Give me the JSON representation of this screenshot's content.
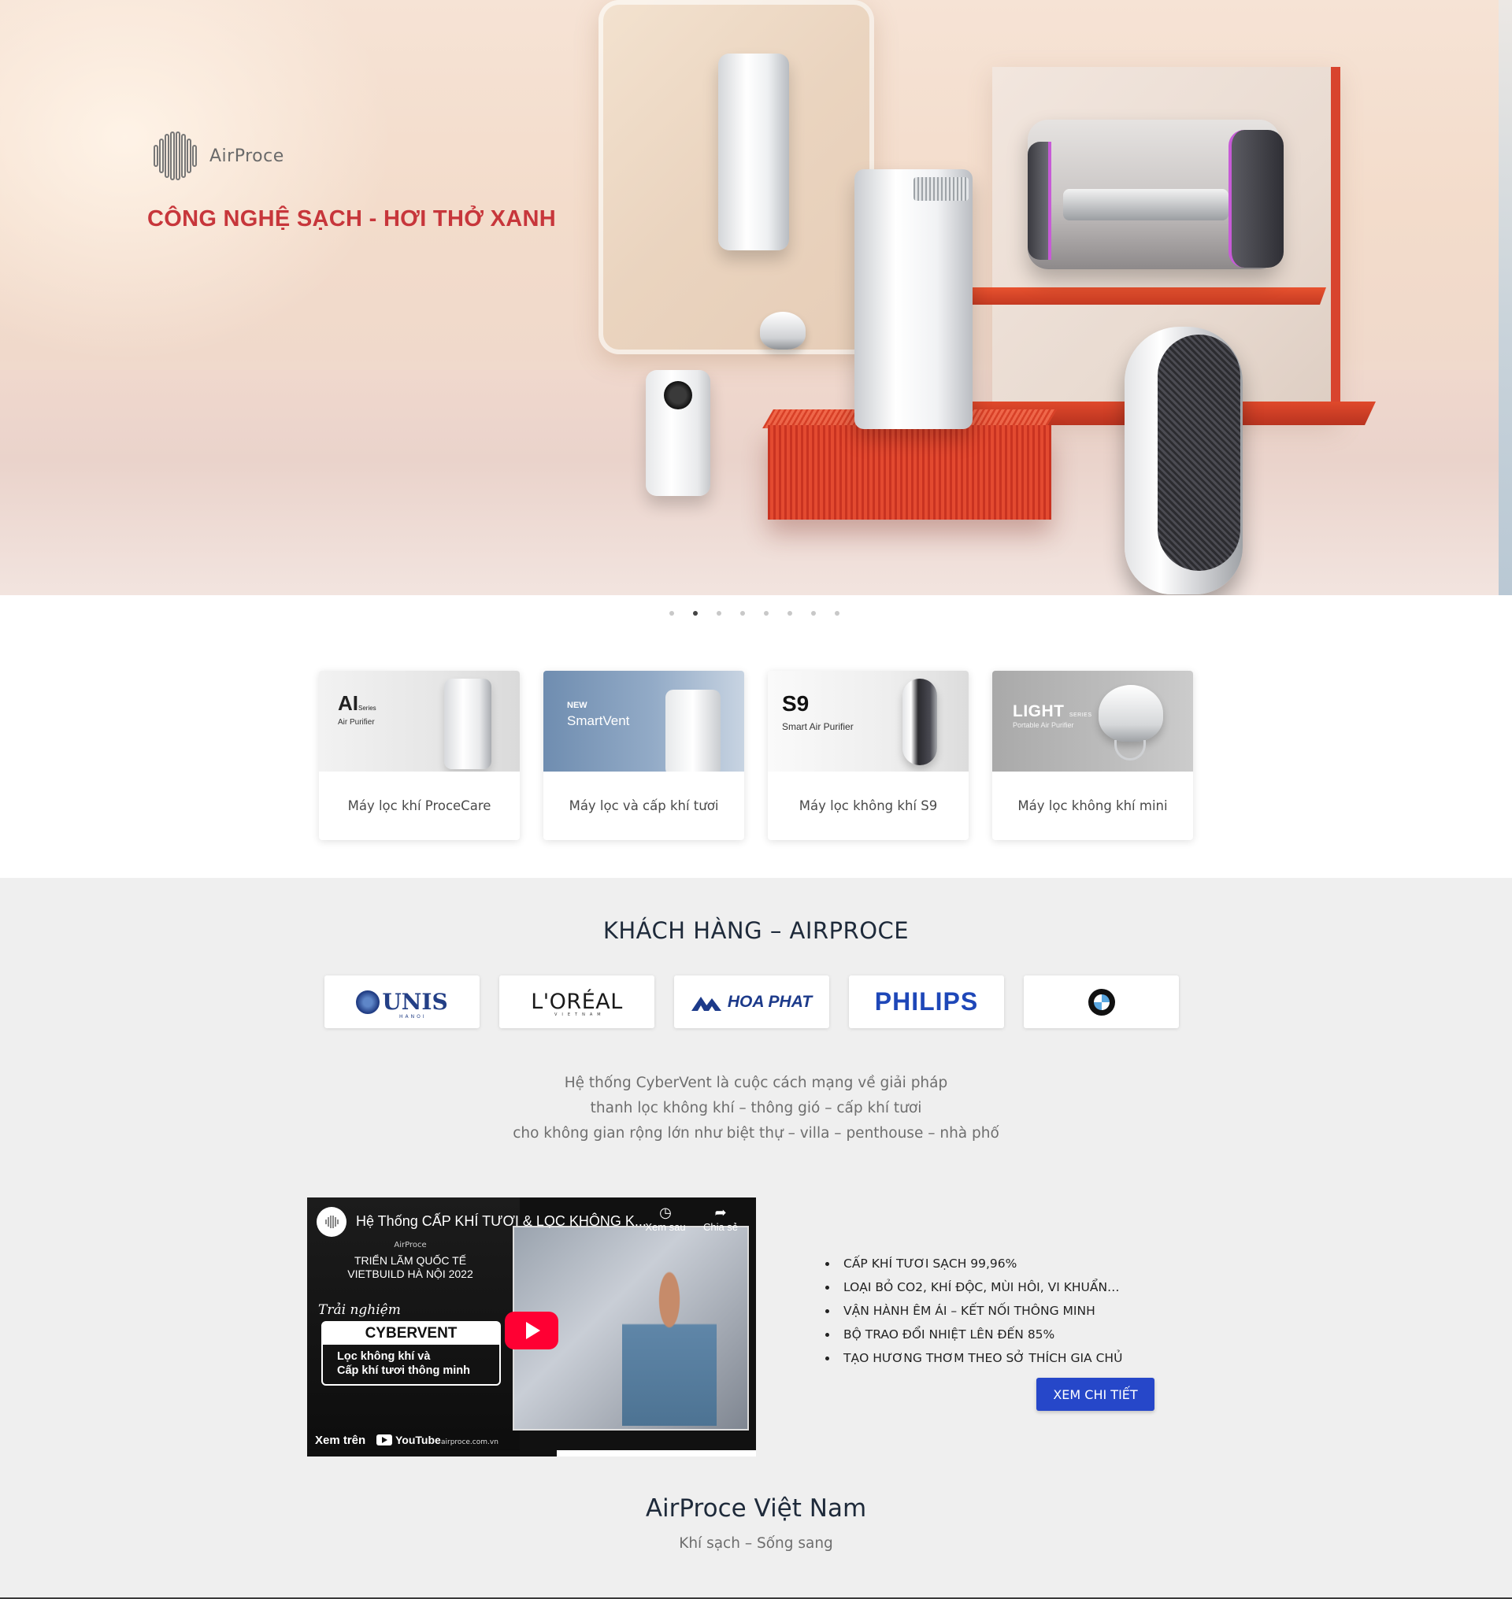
{
  "hero": {
    "brand": "AirProce",
    "tagline": "CÔNG NGHỆ SẠCH - HƠI THỞ XANH",
    "slide_count": 8,
    "active_slide": 2
  },
  "products": [
    {
      "label": "Máy lọc khí ProceCare",
      "img_title": "AI",
      "img_sup": "Series",
      "img_sub": "Air Purifier"
    },
    {
      "label": "Máy lọc và cấp khí tươi",
      "img_new": "NEW",
      "img_title": "SmartVent"
    },
    {
      "label": "Máy lọc không khí S9",
      "img_title": "S9",
      "img_sub": "Smart Air Purifier"
    },
    {
      "label": "Máy lọc không khí mini",
      "img_title": "LIGHT",
      "img_sup": "SERIES",
      "img_sub": "Portable Air Purifier"
    }
  ],
  "clients": {
    "title": "KHÁCH HÀNG – AIRPROCE",
    "logos": [
      {
        "name": "UNIS",
        "sub": "HANOI"
      },
      {
        "name": "L'ORÉAL",
        "sub": "VIETNAM"
      },
      {
        "name": "HOA PHAT"
      },
      {
        "name": "PHILIPS"
      },
      {
        "name": "BMW"
      }
    ]
  },
  "description": {
    "line1": "Hệ thống CyberVent là cuộc cách mạng về giải pháp",
    "line2": "thanh lọc không khí – thông gió – cấp khí tươi",
    "line3": "cho không gian rộng lớn như biệt thự – villa – penthouse – nhà phố"
  },
  "video": {
    "title": "Hệ Thống CẤP KHÍ TƯƠI & LỌC KHÔNG K...",
    "watch_later": "Xem sau",
    "share": "Chia sẻ",
    "brand": "AirProce",
    "expo_line1": "TRIỂN LÃM QUỐC TẾ",
    "expo_line2": "VIETBUILD HÀ NỘI 2022",
    "script": "Trải nghiệm",
    "box_title": "CYBERVENT",
    "box_line1": "Lọc không khí và",
    "box_line2": "Cấp khí tươi thông minh",
    "watch_on": "Xem trên",
    "youtube": "YouTube",
    "site": "airproce.com.vn"
  },
  "features": [
    "CẤP KHÍ TƯƠI SẠCH 99,96%",
    "LOẠI BỎ CO2, KHÍ ĐỘC, MÙI HÔI, VI KHUẨN…",
    "VẬN HÀNH ÊM ÁI – KẾT NỐI THÔNG MINH",
    "BỘ TRAO ĐỔI NHIỆT LÊN ĐẾN 85%",
    "TẠO HƯƠNG THƠM THEO SỞ THÍCH GIA CHỦ"
  ],
  "cta_label": "XEM CHI TIẾT",
  "footer": {
    "title": "AirProce Việt Nam",
    "subtitle": "Khí sạch – Sống sang"
  },
  "colors": {
    "tagline": "#c7363b",
    "cta": "#2647c9",
    "section_bg": "#efefef",
    "heading": "#1e2a3a",
    "play_button": "#ff0033"
  },
  "icons": [
    "airproce-logo-icon",
    "clock-icon",
    "share-icon",
    "play-icon",
    "youtube-icon"
  ]
}
